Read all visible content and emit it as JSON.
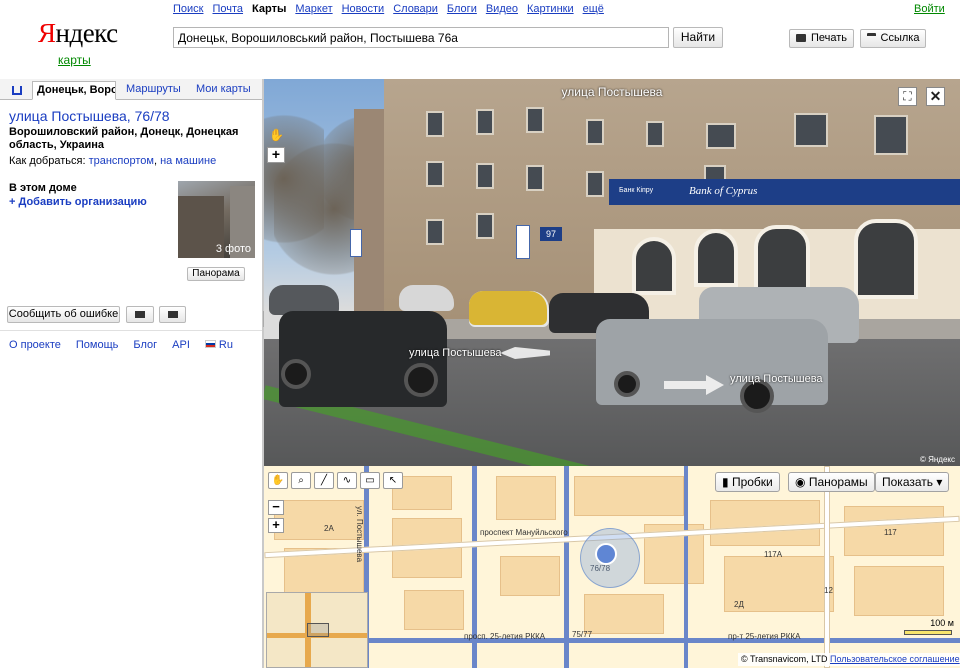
{
  "header": {
    "logo_first": "Я",
    "logo_rest": "ндекс",
    "logo_sub": "карты",
    "nav": [
      "Поиск",
      "Почта",
      "Карты",
      "Маркет",
      "Новости",
      "Словари",
      "Блоги",
      "Видео",
      "Картинки",
      "ещё"
    ],
    "nav_active": "Карты",
    "login": "Войти",
    "search_value": "Донецьк, Ворошиловський район, Постышева 76а",
    "search_button": "Найти",
    "print_button": "Печать",
    "link_button": "Ссылка"
  },
  "tabs": {
    "address": "Донецьк, Вороши",
    "routes": "Маршруты",
    "my_maps": "Мои карты"
  },
  "panel": {
    "title": "улица Постышева, 76/78",
    "subtitle": "Ворошиловский район, Донецк, Донецкая область, Украина",
    "how_to": "Как добраться:",
    "by_transport": "транспортом",
    "separator": ",",
    "by_car": "на машине",
    "in_house": "В этом доме",
    "add_org": "+ Добавить организацию",
    "photos": "3 фото",
    "panorama_button": "Панорама",
    "report_error": "Сообщить об ошибке",
    "footer_links": [
      "О проекте",
      "Помощь",
      "Блог",
      "API"
    ],
    "language": "Ru"
  },
  "panorama": {
    "title": "улица Постышева",
    "street_label_1": "улица Постышева",
    "street_label_2": "улица Постышева",
    "bank_sign": "Bank of Cyprus",
    "bank_sign_local": "Банк Кіпру",
    "house_number": "97",
    "watermark": "© Яндекс"
  },
  "map": {
    "traffic": "Пробки",
    "panoramas": "Панорамы",
    "show": "Показать ▾",
    "scale": "100 м",
    "copyright": "© Transnavicom, LTD",
    "agreement": "Пользовательское соглашение",
    "labels": [
      "2А",
      "117А",
      "75/77",
      "76/78",
      "2Д",
      "12",
      "117",
      "проспект Мануйльского",
      "просп. 25-летия РККА",
      "пр-т 25-летия РККА",
      "ул. Постышева"
    ]
  },
  "colors": {
    "link": "#1a3dc1",
    "logo_red": "#e00000",
    "logo_green": "#008800",
    "bank_blue": "#1d3e87",
    "map_block": "#f6d9a7",
    "map_road_major": "#6a86c9"
  }
}
